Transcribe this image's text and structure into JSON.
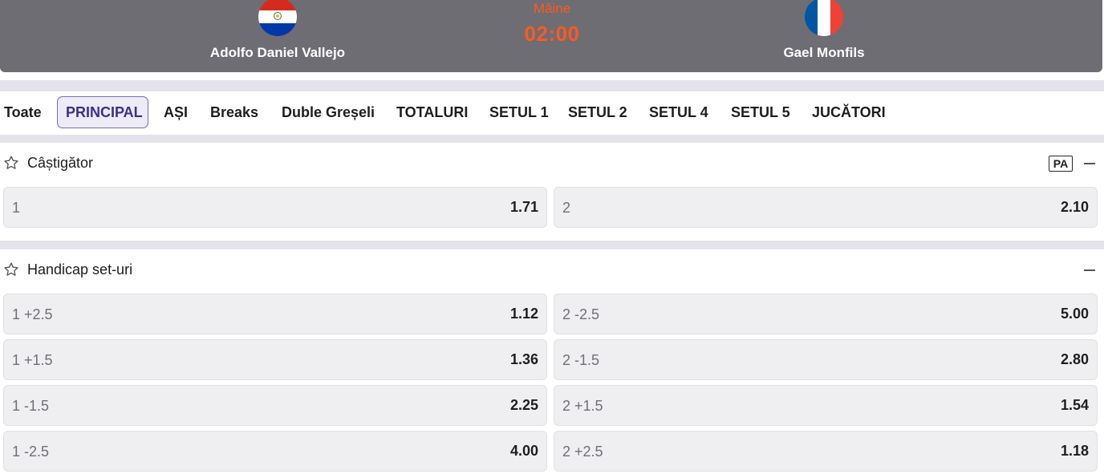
{
  "header": {
    "home_name": "Adolfo Daniel Vallejo",
    "away_name": "Gael Monfils",
    "day": "Mâine",
    "time": "02:00",
    "home_flag": "paraguay-flag-icon",
    "away_flag": "france-flag-icon",
    "accent": "#ff5a1f"
  },
  "tabs": [
    "Toate",
    "PRINCIPAL",
    "AȘI",
    "Breaks",
    "Duble Greșeli",
    "TOTALURI",
    "SETUL 1",
    "SETUL 2",
    "SETUL 4",
    "SETUL 5",
    "JUCĂTORI"
  ],
  "active_tab": "PRINCIPAL",
  "markets": {
    "winner": {
      "title": "Câștigător",
      "badge": "PA",
      "odds": [
        {
          "label": "1",
          "value": "1.71"
        },
        {
          "label": "2",
          "value": "2.10"
        }
      ]
    },
    "handicap": {
      "title": "Handicap set-uri",
      "rows": [
        [
          {
            "label": "1 +2.5",
            "value": "1.12"
          },
          {
            "label": "2 -2.5",
            "value": "5.00"
          }
        ],
        [
          {
            "label": "1 +1.5",
            "value": "1.36"
          },
          {
            "label": "2 -1.5",
            "value": "2.80"
          }
        ],
        [
          {
            "label": "1 -1.5",
            "value": "2.25"
          },
          {
            "label": "2 +1.5",
            "value": "1.54"
          }
        ],
        [
          {
            "label": "1 -2.5",
            "value": "4.00"
          },
          {
            "label": "2 +2.5",
            "value": "1.18"
          }
        ]
      ]
    }
  }
}
